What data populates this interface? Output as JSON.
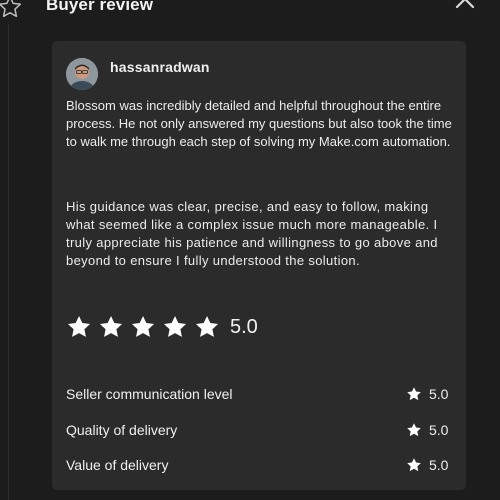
{
  "header": {
    "title": "Buyer review"
  },
  "review": {
    "username": "hassanradwan",
    "paragraphs": [
      "Blossom was incredibly detailed and helpful throughout the entire process. He not only answered my questions but also took the time to walk me through each step of solving my Make.com automation.",
      "His guidance was clear, precise, and easy to follow, making what seemed like a complex issue much more manageable. I truly appreciate his patience and willingness to go above and beyond to ensure I fully understood the solution."
    ],
    "rating": {
      "stars": 5,
      "max_stars": 5,
      "score": "5.0"
    },
    "metrics": [
      {
        "label": "Seller communication level",
        "score": "5.0"
      },
      {
        "label": "Quality of delivery",
        "score": "5.0"
      },
      {
        "label": "Value of delivery",
        "score": "5.0"
      }
    ]
  },
  "colors": {
    "background": "#1c1c1c",
    "card": "#2b2b2b",
    "text": "#f0f0f0",
    "star": "#ffffff"
  },
  "icons": [
    "star-outline-icon",
    "chevron-up-icon",
    "star-icon"
  ]
}
